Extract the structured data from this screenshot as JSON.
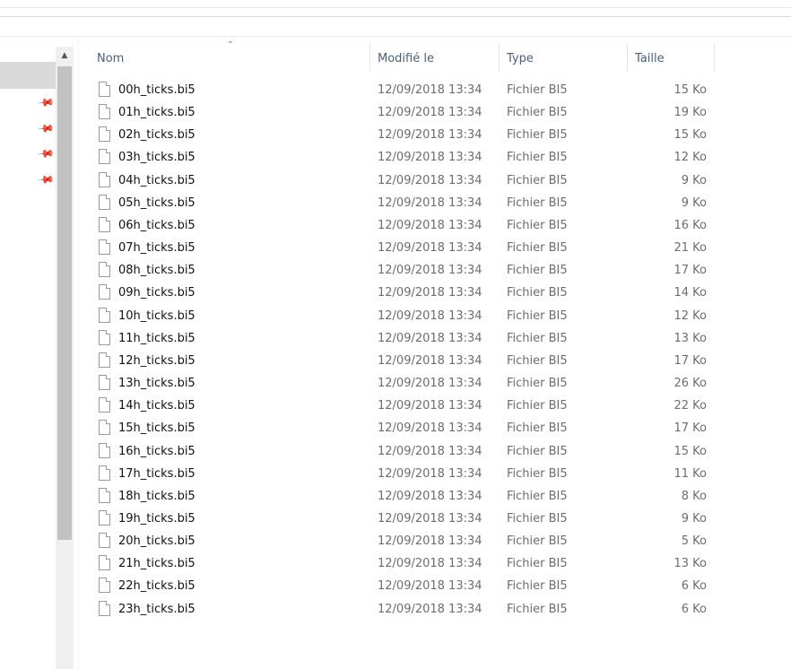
{
  "columns": {
    "name": "Nom",
    "modified": "Modifié le",
    "type": "Type",
    "size": "Taille"
  },
  "icons": {
    "sort": "sort-ascending-icon",
    "file": "file-icon",
    "pin": "pin-icon",
    "scroll_up": "chevron-up-icon"
  },
  "files": [
    {
      "name": "00h_ticks.bi5",
      "modified": "12/09/2018 13:34",
      "type": "Fichier BI5",
      "size": "15 Ko"
    },
    {
      "name": "01h_ticks.bi5",
      "modified": "12/09/2018 13:34",
      "type": "Fichier BI5",
      "size": "19 Ko"
    },
    {
      "name": "02h_ticks.bi5",
      "modified": "12/09/2018 13:34",
      "type": "Fichier BI5",
      "size": "15 Ko"
    },
    {
      "name": "03h_ticks.bi5",
      "modified": "12/09/2018 13:34",
      "type": "Fichier BI5",
      "size": "12 Ko"
    },
    {
      "name": "04h_ticks.bi5",
      "modified": "12/09/2018 13:34",
      "type": "Fichier BI5",
      "size": "9 Ko"
    },
    {
      "name": "05h_ticks.bi5",
      "modified": "12/09/2018 13:34",
      "type": "Fichier BI5",
      "size": "9 Ko"
    },
    {
      "name": "06h_ticks.bi5",
      "modified": "12/09/2018 13:34",
      "type": "Fichier BI5",
      "size": "16 Ko"
    },
    {
      "name": "07h_ticks.bi5",
      "modified": "12/09/2018 13:34",
      "type": "Fichier BI5",
      "size": "21 Ko"
    },
    {
      "name": "08h_ticks.bi5",
      "modified": "12/09/2018 13:34",
      "type": "Fichier BI5",
      "size": "17 Ko"
    },
    {
      "name": "09h_ticks.bi5",
      "modified": "12/09/2018 13:34",
      "type": "Fichier BI5",
      "size": "14 Ko"
    },
    {
      "name": "10h_ticks.bi5",
      "modified": "12/09/2018 13:34",
      "type": "Fichier BI5",
      "size": "12 Ko"
    },
    {
      "name": "11h_ticks.bi5",
      "modified": "12/09/2018 13:34",
      "type": "Fichier BI5",
      "size": "13 Ko"
    },
    {
      "name": "12h_ticks.bi5",
      "modified": "12/09/2018 13:34",
      "type": "Fichier BI5",
      "size": "17 Ko"
    },
    {
      "name": "13h_ticks.bi5",
      "modified": "12/09/2018 13:34",
      "type": "Fichier BI5",
      "size": "26 Ko"
    },
    {
      "name": "14h_ticks.bi5",
      "modified": "12/09/2018 13:34",
      "type": "Fichier BI5",
      "size": "22 Ko"
    },
    {
      "name": "15h_ticks.bi5",
      "modified": "12/09/2018 13:34",
      "type": "Fichier BI5",
      "size": "17 Ko"
    },
    {
      "name": "16h_ticks.bi5",
      "modified": "12/09/2018 13:34",
      "type": "Fichier BI5",
      "size": "15 Ko"
    },
    {
      "name": "17h_ticks.bi5",
      "modified": "12/09/2018 13:34",
      "type": "Fichier BI5",
      "size": "11 Ko"
    },
    {
      "name": "18h_ticks.bi5",
      "modified": "12/09/2018 13:34",
      "type": "Fichier BI5",
      "size": "8 Ko"
    },
    {
      "name": "19h_ticks.bi5",
      "modified": "12/09/2018 13:34",
      "type": "Fichier BI5",
      "size": "9 Ko"
    },
    {
      "name": "20h_ticks.bi5",
      "modified": "12/09/2018 13:34",
      "type": "Fichier BI5",
      "size": "5 Ko"
    },
    {
      "name": "21h_ticks.bi5",
      "modified": "12/09/2018 13:34",
      "type": "Fichier BI5",
      "size": "13 Ko"
    },
    {
      "name": "22h_ticks.bi5",
      "modified": "12/09/2018 13:34",
      "type": "Fichier BI5",
      "size": "6 Ko"
    },
    {
      "name": "23h_ticks.bi5",
      "modified": "12/09/2018 13:34",
      "type": "Fichier BI5",
      "size": "6 Ko"
    }
  ]
}
